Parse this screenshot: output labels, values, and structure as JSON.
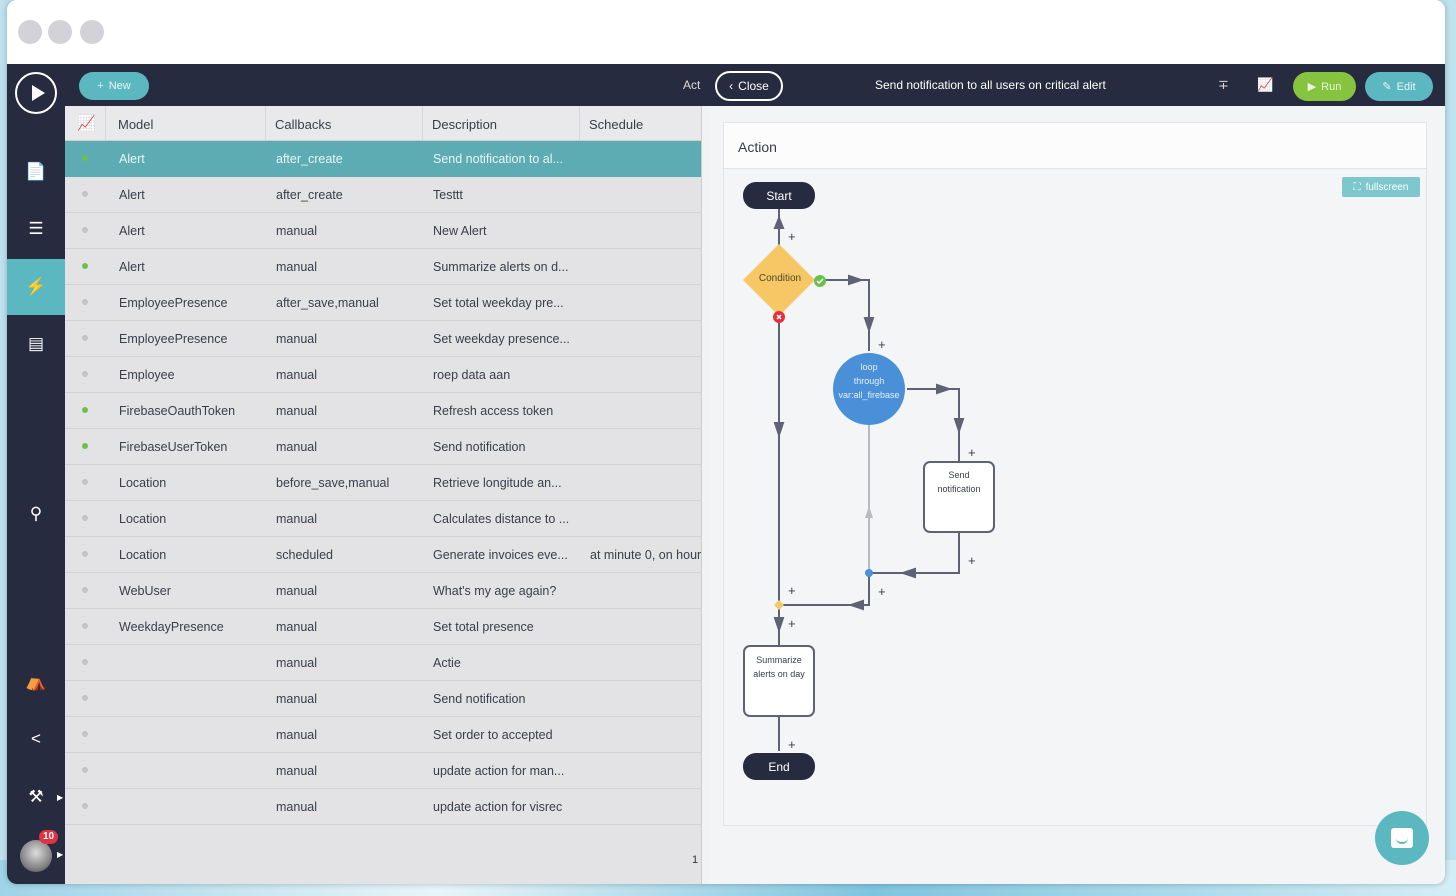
{
  "window": {
    "controls": [
      "close",
      "minimize",
      "maximize"
    ]
  },
  "topbar": {
    "new_label": "New",
    "act_label": "Act",
    "close_label": "Close",
    "title": "Send notification to all users on critical alert",
    "run_label": "Run",
    "edit_label": "Edit"
  },
  "sidebar": {
    "items": [
      {
        "icon": "file-icon",
        "active": false
      },
      {
        "icon": "database-icon",
        "active": false
      },
      {
        "icon": "lightning-icon",
        "active": true
      },
      {
        "icon": "server-icon",
        "active": false
      },
      {
        "icon": "search-icon",
        "active": false
      },
      {
        "icon": "store-icon",
        "active": false
      },
      {
        "icon": "share-icon",
        "active": false
      },
      {
        "icon": "tools-icon",
        "active": false
      }
    ],
    "notification_count": "10"
  },
  "table": {
    "columns": [
      "Model",
      "Callbacks",
      "Description",
      "Schedule"
    ],
    "rows": [
      {
        "status": "active",
        "model": "Alert",
        "callbacks": "after_create",
        "description": "Send notification to al...",
        "schedule": "",
        "selected": true
      },
      {
        "status": "inactive",
        "model": "Alert",
        "callbacks": "after_create",
        "description": "Testtt",
        "schedule": ""
      },
      {
        "status": "inactive",
        "model": "Alert",
        "callbacks": "manual",
        "description": "New Alert",
        "schedule": ""
      },
      {
        "status": "active",
        "model": "Alert",
        "callbacks": "manual",
        "description": "Summarize alerts on d...",
        "schedule": ""
      },
      {
        "status": "inactive",
        "model": "EmployeePresence",
        "callbacks": "after_save,manual",
        "description": "Set total weekday pre...",
        "schedule": ""
      },
      {
        "status": "inactive",
        "model": "EmployeePresence",
        "callbacks": "manual",
        "description": "Set weekday presence...",
        "schedule": ""
      },
      {
        "status": "inactive",
        "model": "Employee",
        "callbacks": "manual",
        "description": "roep data aan",
        "schedule": ""
      },
      {
        "status": "active",
        "model": "FirebaseOauthToken",
        "callbacks": "manual",
        "description": "Refresh access token",
        "schedule": ""
      },
      {
        "status": "active",
        "model": "FirebaseUserToken",
        "callbacks": "manual",
        "description": "Send notification",
        "schedule": ""
      },
      {
        "status": "inactive",
        "model": "Location",
        "callbacks": "before_save,manual",
        "description": "Retrieve longitude an...",
        "schedule": ""
      },
      {
        "status": "inactive",
        "model": "Location",
        "callbacks": "manual",
        "description": "Calculates distance to ...",
        "schedule": ""
      },
      {
        "status": "inactive",
        "model": "Location",
        "callbacks": "scheduled",
        "description": "Generate invoices eve...",
        "schedule": "at minute 0, on hour"
      },
      {
        "status": "inactive",
        "model": "WebUser",
        "callbacks": "manual",
        "description": "What's my age again?",
        "schedule": ""
      },
      {
        "status": "inactive",
        "model": "WeekdayPresence",
        "callbacks": "manual",
        "description": "Set total presence",
        "schedule": ""
      },
      {
        "status": "inactive",
        "model": "",
        "callbacks": "manual",
        "description": "Actie",
        "schedule": ""
      },
      {
        "status": "inactive",
        "model": "",
        "callbacks": "manual",
        "description": "Send notification",
        "schedule": ""
      },
      {
        "status": "inactive",
        "model": "",
        "callbacks": "manual",
        "description": "Set order to accepted",
        "schedule": ""
      },
      {
        "status": "inactive",
        "model": "",
        "callbacks": "manual",
        "description": "update action for man...",
        "schedule": ""
      },
      {
        "status": "inactive",
        "model": "",
        "callbacks": "manual",
        "description": "update action for visrec",
        "schedule": ""
      }
    ],
    "page": "1"
  },
  "panel": {
    "title": "Action",
    "fullscreen_label": "fullscreen",
    "flow": {
      "start": "Start",
      "condition": "Condition",
      "loop": [
        "loop",
        "through",
        "var:all_firebase"
      ],
      "send": [
        "Send",
        "notification"
      ],
      "summarize": [
        "Summarize",
        "alerts on day"
      ],
      "end": "End",
      "add": "+"
    }
  },
  "colors": {
    "accent": "#5bb8c1",
    "dark": "#272b40",
    "run": "#86c440",
    "active_dot": "#6cc04a",
    "condition": "#f8c765",
    "loop": "#4a90d9"
  }
}
